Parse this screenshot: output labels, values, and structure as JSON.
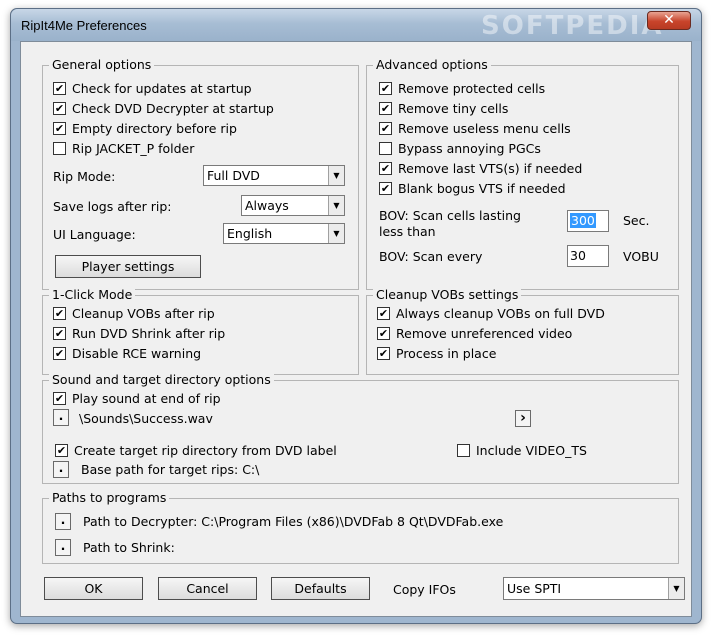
{
  "window": {
    "title": "RipIt4Me Preferences",
    "watermark": "SOFTPEDIA",
    "close_glyph": "✕"
  },
  "general": {
    "legend": "General options",
    "checks": [
      {
        "label": "Check for updates at startup",
        "checked": true
      },
      {
        "label": "Check DVD Decrypter at startup",
        "checked": true
      },
      {
        "label": "Empty directory before rip",
        "checked": true
      },
      {
        "label": "Rip JACKET_P folder",
        "checked": false
      }
    ],
    "rip_mode_label": "Rip Mode:",
    "rip_mode_value": "Full DVD",
    "save_logs_label": "Save logs after rip:",
    "save_logs_value": "Always",
    "ui_language_label": "UI Language:",
    "ui_language_value": "English",
    "player_settings_label": "Player settings"
  },
  "advanced": {
    "legend": "Advanced options",
    "checks": [
      {
        "label": "Remove protected cells",
        "checked": true
      },
      {
        "label": "Remove tiny cells",
        "checked": true
      },
      {
        "label": "Remove useless menu cells",
        "checked": true
      },
      {
        "label": "Bypass annoying PGCs",
        "checked": false
      },
      {
        "label": "Remove last VTS(s) if needed",
        "checked": true
      },
      {
        "label": "Blank bogus VTS if needed",
        "checked": true
      }
    ],
    "bov_cells_label_1": "BOV: Scan cells lasting",
    "bov_cells_label_2": "less than",
    "bov_cells_value": "300",
    "bov_cells_unit": "Sec.",
    "bov_scan_label": "BOV: Scan every",
    "bov_scan_value": "30",
    "bov_scan_unit": "VOBU"
  },
  "oneclick": {
    "legend": "1-Click Mode",
    "checks": [
      {
        "label": "Cleanup VOBs after rip",
        "checked": true
      },
      {
        "label": "Run DVD Shrink after rip",
        "checked": true
      },
      {
        "label": "Disable RCE warning",
        "checked": true
      }
    ]
  },
  "cleanup": {
    "legend": "Cleanup VOBs settings",
    "checks": [
      {
        "label": "Always cleanup VOBs on full DVD",
        "checked": true
      },
      {
        "label": "Remove unreferenced video",
        "checked": true
      },
      {
        "label": "Process in place",
        "checked": true
      }
    ]
  },
  "sound": {
    "legend": "Sound and target directory options",
    "play_sound_label": "Play sound at end of rip",
    "play_sound_checked": true,
    "sound_path": "\\Sounds\\Success.wav",
    "play_button_glyph": "›",
    "create_target_label": "Create target rip directory from DVD label",
    "create_target_checked": true,
    "include_video_ts_label": "Include VIDEO_TS",
    "include_video_ts_checked": false,
    "base_path_label": "Base path for target rips: C:\\",
    "browse_glyph": "."
  },
  "paths": {
    "legend": "Paths to programs",
    "decrypter_label": "Path to Decrypter: C:\\Program Files (x86)\\DVDFab 8 Qt\\DVDFab.exe",
    "shrink_label": "Path to Shrink:"
  },
  "footer": {
    "ok_label": "OK",
    "cancel_label": "Cancel",
    "defaults_label": "Defaults",
    "copy_ifos_label": "Copy IFOs",
    "copy_ifos_value": "Use SPTI"
  },
  "check_glyph": "✔",
  "combo_arrow_glyph": "▼"
}
